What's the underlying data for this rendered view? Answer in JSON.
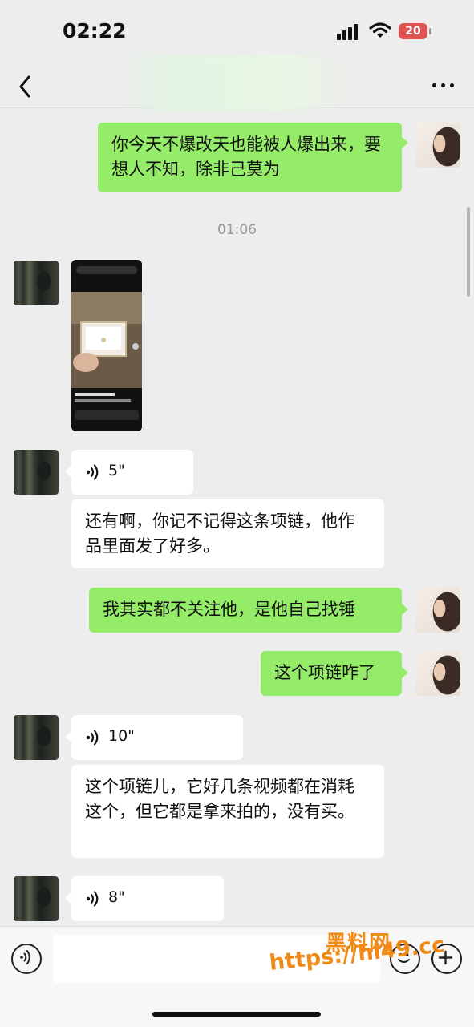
{
  "status_bar": {
    "time": "02:22",
    "battery": "20"
  },
  "header": {
    "back_icon": "chevron-left-icon",
    "more_icon": "more-dots-icon"
  },
  "messages": [
    {
      "sender": "me",
      "type": "text",
      "text": "你今天不爆改天也能被人爆出来，要想人不知，除非己莫为"
    },
    {
      "type": "timestamp",
      "text": "01:06"
    },
    {
      "sender": "other",
      "type": "image",
      "description_icon": "screenshot-thumbnail"
    },
    {
      "sender": "other",
      "type": "voice",
      "duration": "5\""
    },
    {
      "sender": "other",
      "type": "text",
      "text": "还有啊，你记不记得这条项链，他作品里面发了好多。"
    },
    {
      "sender": "me",
      "type": "text",
      "text": "我其实都不关注他，是他自己找锤"
    },
    {
      "sender": "me",
      "type": "text",
      "text": "这个项链咋了"
    },
    {
      "sender": "other",
      "type": "voice",
      "duration": "10\""
    },
    {
      "sender": "other",
      "type": "text",
      "text": "这个项链儿，它好几条视频都在消耗这个，但它都是拿来拍的，没有买。"
    },
    {
      "sender": "other",
      "type": "voice",
      "duration": "8\""
    }
  ],
  "input_bar": {
    "voice_icon": "voice-input-icon",
    "emoji_icon": "emoji-icon",
    "plus_icon": "plus-icon",
    "placeholder": ""
  },
  "watermark": {
    "line1": "黑料网",
    "line2": "https://hl49.cc"
  },
  "colors": {
    "my_bubble": "#95ec69",
    "other_bubble": "#ffffff",
    "background": "#ededed",
    "watermark": "#f08a16"
  }
}
